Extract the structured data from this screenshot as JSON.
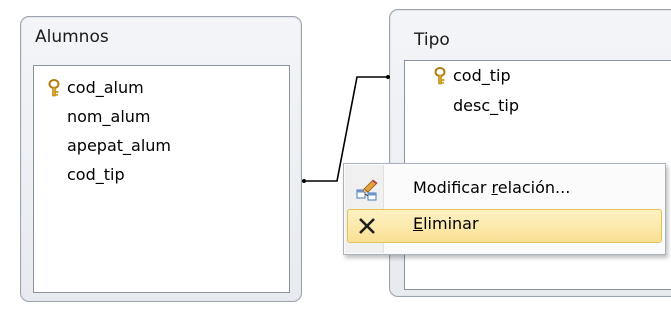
{
  "tables": [
    {
      "title": "Alumnos",
      "fields": [
        {
          "name": "cod_alum",
          "key": true
        },
        {
          "name": "nom_alum",
          "key": false
        },
        {
          "name": "apepat_alum",
          "key": false
        },
        {
          "name": "cod_tip",
          "key": false
        }
      ]
    },
    {
      "title": "Tipo",
      "fields": [
        {
          "name": "cod_tip",
          "key": true
        },
        {
          "name": "desc_tip",
          "key": false
        }
      ]
    }
  ],
  "context_menu": {
    "items": [
      {
        "label_pre": "Modificar ",
        "label_accel": "r",
        "label_post": "elación...",
        "icon": "edit-relationship-icon"
      },
      {
        "label_pre": "",
        "label_accel": "E",
        "label_post": "liminar",
        "icon": "delete-x-icon"
      }
    ]
  },
  "colors": {
    "highlight_top": "#fdf2c4",
    "highlight_bottom": "#fbe095",
    "key_gold": "#d8a425"
  }
}
